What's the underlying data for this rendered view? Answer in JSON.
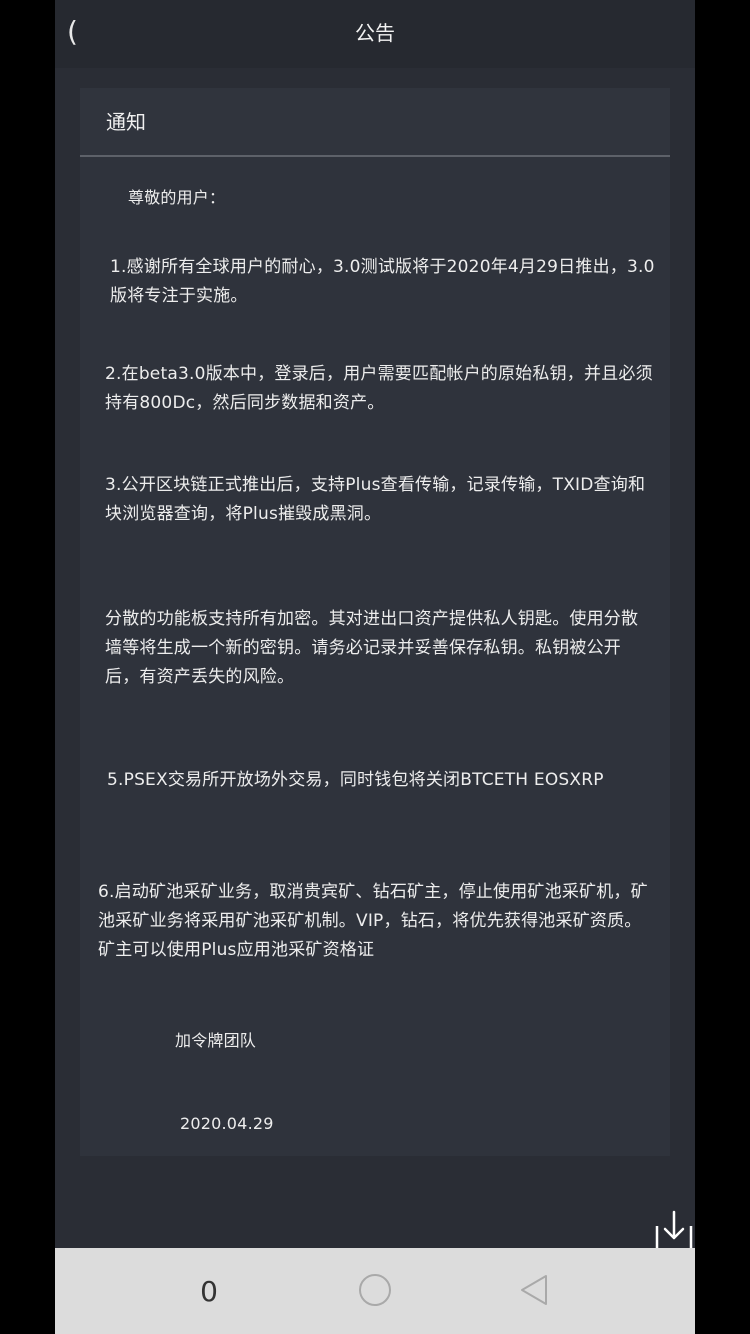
{
  "header": {
    "back_glyph": "(",
    "title": "公告"
  },
  "card": {
    "title": "通知",
    "greeting": "尊敬的用户：",
    "paragraphs": [
      "1.感谢所有全球用户的耐心，3.0测试版将于2020年4月29日推出，3.0版将专注于实施。",
      "2.在beta3.0版本中，登录后，用户需要匹配帐户的原始私钥，并且必须持有800Dc，然后同步数据和资产。",
      "3.公开区块链正式推出后，支持Plus查看传输，记录传输，TXID查询和块浏览器查询，将Plus摧毁成黑洞。",
      "分散的功能板支持所有加密。其对进出口资产提供私人钥匙。使用分散墙等将生成一个新的密钥。请务必记录并妥善保存私钥。私钥被公开后，有资产丢失的风险。",
      "5.PSEX交易所开放场外交易，同时钱包将关闭BTCETH EOSXRP",
      "6.启动矿池采矿业务，取消贵宾矿、钻石矿主，停止使用矿池采矿机，矿池采矿业务将采用矿池采矿机制。VIP，钻石，将优先获得池采矿资质。矿主可以使用Plus应用池采矿资格证"
    ],
    "signature": "加令牌团队",
    "date": "2020.04.29"
  },
  "navbar": {
    "recent_glyph": "0"
  },
  "icons": {
    "download": "download-icon",
    "home": "home-circle-icon",
    "back": "back-triangle-icon"
  },
  "colors": {
    "background": "#2a2d35",
    "card": "#2f333c",
    "text": "#ededed",
    "navbar": "#dcdcdc"
  }
}
